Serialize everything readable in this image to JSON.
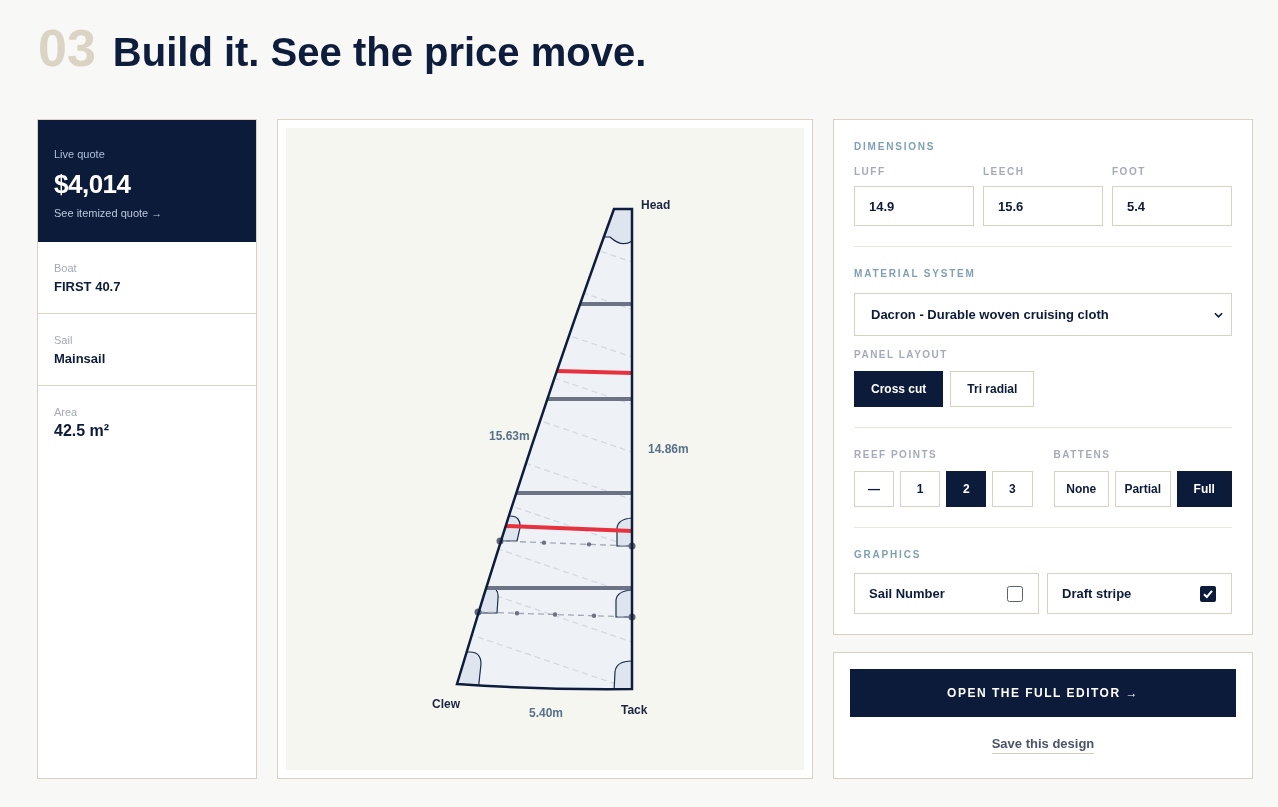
{
  "section": {
    "number": "03",
    "title": "Build it. See the price move."
  },
  "summary": {
    "quote_label": "Live quote",
    "price": "$4,014",
    "quote_link": "See itemized quote →",
    "specs": [
      {
        "label": "Boat",
        "value": "FIRST 40.7"
      },
      {
        "label": "Sail",
        "value": "Mainsail"
      },
      {
        "label": "Area",
        "value": "42.5 m²"
      }
    ]
  },
  "diagram": {
    "labels": [
      {
        "kind": "head",
        "text": "Head"
      },
      {
        "kind": "leech",
        "text": "15.63m"
      },
      {
        "kind": "luff",
        "text": "14.86m"
      },
      {
        "kind": "clew",
        "text": "Clew"
      },
      {
        "kind": "foot",
        "text": "5.40m"
      },
      {
        "kind": "tack",
        "text": "Tack"
      }
    ]
  },
  "configurator": {
    "dimensions": {
      "title": "DIMENSIONS",
      "fields": [
        {
          "label": "LUFF",
          "value": "14.9"
        },
        {
          "label": "LEECH",
          "value": "15.6"
        },
        {
          "label": "FOOT",
          "value": "5.4"
        }
      ]
    },
    "material": {
      "title": "MATERIAL SYSTEM",
      "value": "Dacron - Durable woven cruising cloth"
    },
    "panel_layout": {
      "title": "PANEL LAYOUT",
      "options": [
        {
          "label": "Cross cut",
          "selected": true
        },
        {
          "label": "Tri radial",
          "selected": false
        }
      ]
    },
    "reef_points": {
      "title": "REEF POINTS",
      "options": [
        {
          "label": "—",
          "selected": false
        },
        {
          "label": "1",
          "selected": false
        },
        {
          "label": "2",
          "selected": true
        },
        {
          "label": "3",
          "selected": false
        }
      ]
    },
    "battens": {
      "title": "BATTENS",
      "options": [
        {
          "label": "None",
          "selected": false
        },
        {
          "label": "Partial",
          "selected": false
        },
        {
          "label": "Full",
          "selected": true
        }
      ]
    },
    "graphics": {
      "title": "GRAPHICS",
      "options": [
        {
          "label": "Sail Number",
          "checked": false
        },
        {
          "label": "Draft stripe",
          "checked": true
        }
      ]
    }
  },
  "actions": {
    "primary": "OPEN THE FULL EDITOR →",
    "secondary": "Save this design"
  }
}
